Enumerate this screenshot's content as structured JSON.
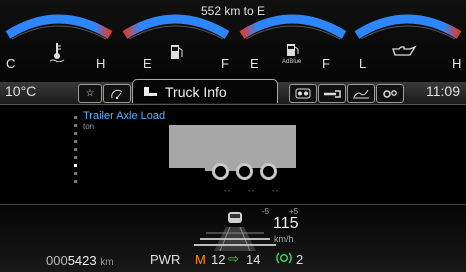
{
  "range_text": "552 km to E",
  "gauges": [
    {
      "name": "coolant",
      "left": "C",
      "right": "H",
      "icon": "coolant-temperature-icon"
    },
    {
      "name": "fuel",
      "left": "E",
      "right": "F",
      "icon": "fuel-pump-icon"
    },
    {
      "name": "adblue",
      "left": "E",
      "right": "F",
      "icon": "adblue-icon",
      "icon_label": "AdBlue"
    },
    {
      "name": "oil",
      "left": "L",
      "right": "H",
      "icon": "oil-can-icon"
    }
  ],
  "colors": {
    "gauge_low": "#2e86ff",
    "gauge_high": "#e23a2a",
    "accent_blue": "#5fb2ff",
    "gear_orange": "#ff8a1f",
    "green": "#3ccf5a"
  },
  "tabbar": {
    "temperature": "10°C",
    "clock": "11:09",
    "active_tab": "Truck Info",
    "tabs_left": [
      "star-icon",
      "tachograph-icon"
    ],
    "tabs_right": [
      "trip-icon",
      "wrench-icon",
      "road-icon",
      "settings-icon"
    ]
  },
  "axle_panel": {
    "title": "Trailer Axle Load",
    "unit": "ton",
    "axle_values": [
      "--",
      "--",
      "--"
    ],
    "scale_level": 0.2
  },
  "status": {
    "odometer_prefix": "000",
    "odometer_value": "5423",
    "odometer_unit": "km",
    "mode": "PWR",
    "gear_mode": "M",
    "gear_current": "12",
    "gear_arrow": "⇨",
    "gear_target": "14",
    "acc_value": "2",
    "speed_value": "115",
    "speed_unit": "km/h",
    "speed_minus": "-5",
    "speed_plus": "+5"
  }
}
